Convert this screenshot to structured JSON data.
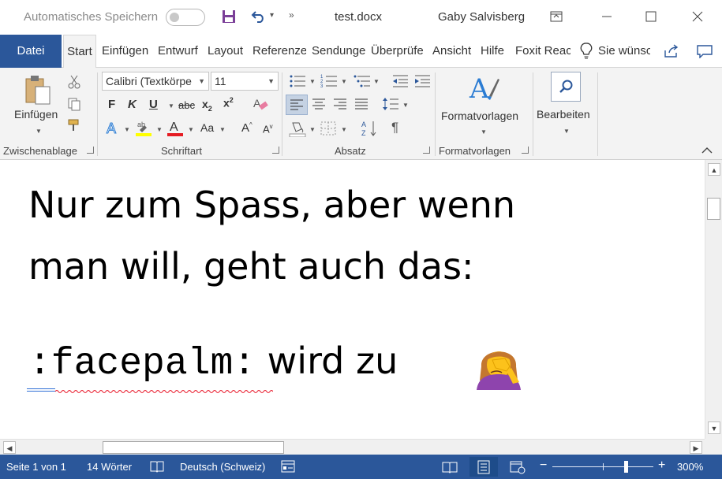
{
  "titlebar": {
    "autosave_label": "Automatisches Speichern",
    "document_title": "test.docx",
    "user_name": "Gaby Salvisberg"
  },
  "tabs": {
    "file": "Datei",
    "start": "Start",
    "insert": "Einfügen",
    "design": "Entwurf",
    "layout": "Layout",
    "references": "Referenze",
    "mailings": "Sendunge",
    "review": "Überprüfe",
    "view": "Ansicht",
    "help": "Hilfe",
    "foxit": "Foxit Reac",
    "tell_me": "Sie wünsc"
  },
  "ribbon": {
    "clipboard": {
      "paste_label": "Einfügen",
      "group_label": "Zwischenablage"
    },
    "font": {
      "font_name": "Calibri (Textkörpе",
      "font_size": "11",
      "group_label": "Schriftart",
      "bold": "F",
      "italic": "K",
      "underline": "U",
      "strike": "abc",
      "grow": "A",
      "shrink": "A",
      "change_case": "Aa"
    },
    "paragraph": {
      "group_label": "Absatz"
    },
    "styles": {
      "button_label": "Formatvorlagen",
      "group_label": "Formatvorlagen"
    },
    "editing": {
      "button_label": "Bearbeiten"
    }
  },
  "document": {
    "line1": "Nur zum Spass, aber wenn",
    "line2": "man will, geht auch das:",
    "code_text": ":facepalm:",
    "after_code": " wird zu",
    "emoji": "🤦‍♀️"
  },
  "statusbar": {
    "page": "Seite 1 von 1",
    "words": "14 Wörter",
    "language": "Deutsch (Schweiz)",
    "zoom": "300%",
    "zoom_fraction": 0.73
  },
  "colors": {
    "accent": "#2b579a",
    "ribbon_bg": "#f3f3f3",
    "spell_error": "#e81123",
    "grammar_mark": "#2f6fd6"
  }
}
